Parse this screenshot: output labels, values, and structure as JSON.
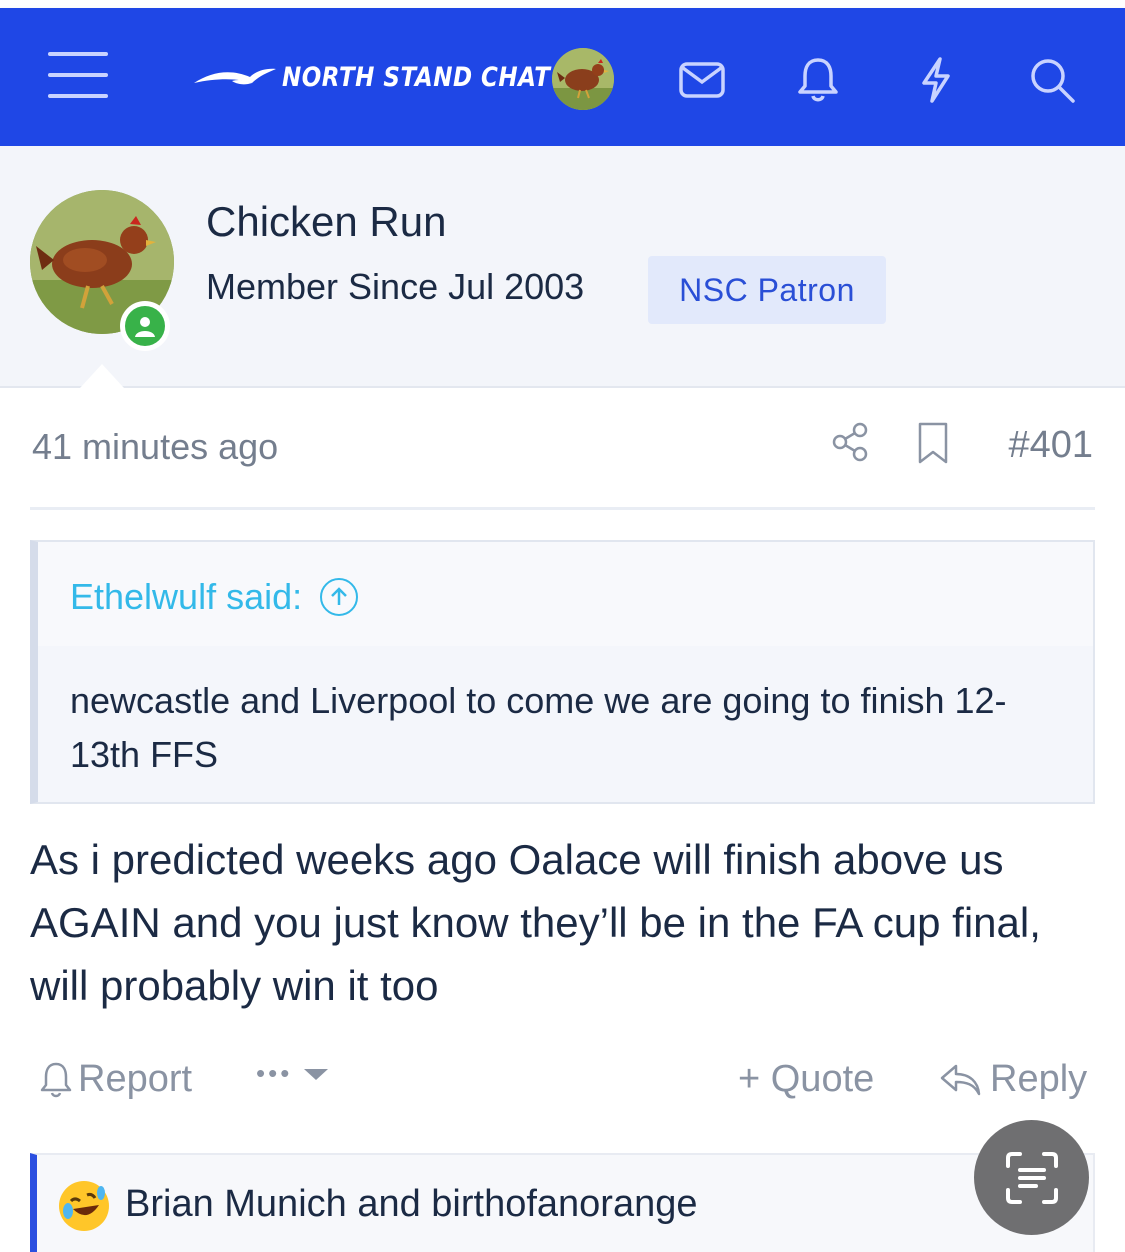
{
  "header": {
    "logo_text": "NORTH STAND CHAT",
    "icons": [
      "menu-icon",
      "logo-seagull-icon",
      "avatar",
      "inbox-icon",
      "bell-icon",
      "lightning-icon",
      "search-icon"
    ],
    "bg_color": "#1f47e6"
  },
  "profile": {
    "name": "Chicken Run",
    "member_since": "Member Since Jul 2003",
    "badge": "NSC Patron",
    "status": "online"
  },
  "post": {
    "time": "41 minutes ago",
    "number": "#401",
    "quote": {
      "author": "Ethelwulf said:",
      "text": "newcastle and Liverpool to come we are going to finish 12-13th FFS"
    },
    "message": "As i predicted weeks ago Oalace will finish above us AGAIN and you just know they’ll be in the FA cup final, will probably win it too",
    "actions": {
      "report": "Report",
      "more": "•••",
      "quote": "+ Quote",
      "reply": "Reply"
    },
    "reactions": {
      "text": "Brian Munich and birthofanorange",
      "emoji": "rofl-emoji"
    }
  }
}
